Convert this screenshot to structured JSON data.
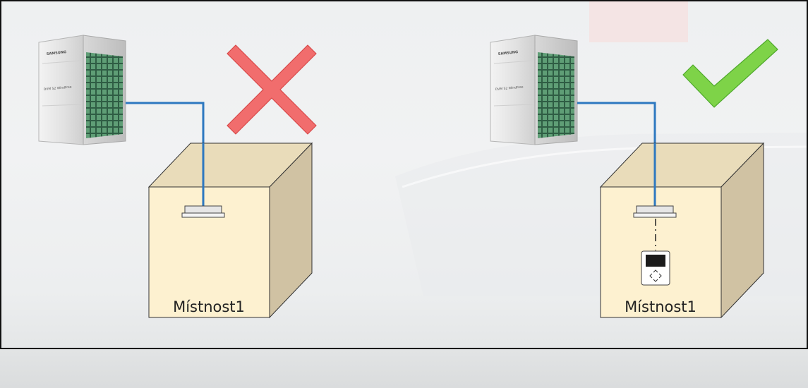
{
  "rooms": {
    "left": {
      "label": "Místnost1"
    },
    "right": {
      "label": "Místnost1"
    }
  },
  "outdoor_units": {
    "brand": "SAMSUNG",
    "model": "DVM S2 WindFree"
  },
  "status_marks": {
    "left": {
      "icon": "cross-icon",
      "color": "#f16d6d"
    },
    "right": {
      "icon": "check-icon",
      "color": "#7ed348"
    }
  },
  "colors": {
    "pipe": "#2d78c0",
    "box_front": "#fdf1d0",
    "box_side": "#d0c2a3",
    "box_top": "#e9dcba"
  }
}
